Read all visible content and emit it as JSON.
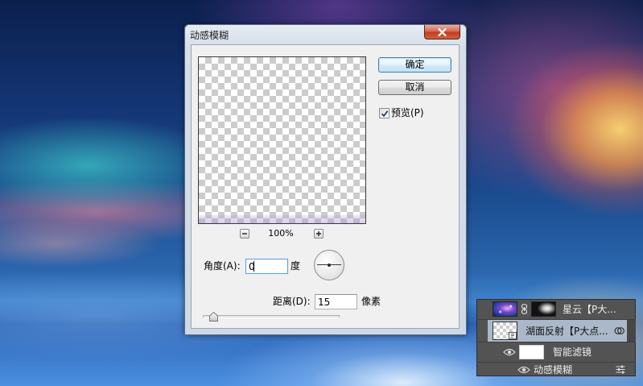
{
  "dialog": {
    "title": "动感模糊",
    "ok_label": "确定",
    "cancel_label": "取消",
    "preview_label": "预览(P)",
    "preview_checked": true,
    "zoom_level": "100%",
    "angle_label": "角度(A):",
    "angle_value": "0",
    "angle_unit": "度",
    "distance_label": "距离(D):",
    "distance_value": "15",
    "distance_unit": "像素",
    "distance_slider_level": 0.08
  },
  "layers_panel": {
    "layers": [
      {
        "name": "星云【P大...",
        "has_mask": true,
        "selected": false
      },
      {
        "name": "湖面反射【P大点...",
        "smart_object": true,
        "selected": true
      },
      {
        "name": "智能滤镜",
        "visible": true,
        "selected": false
      },
      {
        "name": "动感模糊",
        "visible": true,
        "selected": false
      }
    ]
  },
  "icons": {
    "close": "close-icon",
    "zoom_out": "zoom-out-icon",
    "zoom_in": "zoom-in-icon",
    "preview_check": "checkmark-icon",
    "angle_dial": "angle-dial-icon",
    "layer_link": "chain-link-icon",
    "smart_object_badge": "smart-object-icon",
    "smart_filter": "smart-filter-icon",
    "visibility": "eye-icon",
    "filter_blending": "blending-options-icon"
  },
  "colors": {
    "default_button_border": "#3c7fb1",
    "close_button": "#c7452e",
    "focused_field_border": "#569de5",
    "panel_background": "#535353",
    "selected_layer": "#aab8ca"
  }
}
